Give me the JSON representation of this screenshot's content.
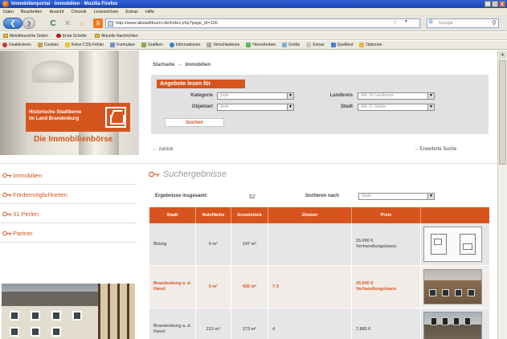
{
  "window": {
    "title": "Immobilienportal · Immobilien · Mozilla Firefox",
    "buttons": {
      "minimize": "_",
      "maximize": "□",
      "close": "X"
    }
  },
  "menu": [
    "Datei",
    "Bearbeiten",
    "Ansicht",
    "Chronik",
    "Lesezeichen",
    "Extras",
    "Hilfe"
  ],
  "nav": {
    "url": "http://www.altstadtbuero.de/index.php?page_id=156",
    "search_placeholder": "Google"
  },
  "bookmarks": [
    "Meistbesuchte Seiten",
    "Erste Schritte",
    "Aktuelle Nachrichten"
  ],
  "toolbar": [
    "Deaktivieren",
    "Cookies",
    "Keine CSS-Fehler",
    "Formulare",
    "Grafiken",
    "Informationen",
    "Verschiedenes",
    "Hervorheben",
    "Größe",
    "Extras",
    "Quelltext",
    "Optionen"
  ],
  "site": {
    "badge_line1": "Historische Stadtkerne",
    "badge_line2": "im Land Brandenburg",
    "title": "Die Immobilienbörse"
  },
  "breadcrumb": {
    "home": "Startseite",
    "sep": "→",
    "current": "Immobilien"
  },
  "search": {
    "heading": "Angebote lesen für",
    "kategorie_label": "Kategorie",
    "kategorie_value": "Jede",
    "objektart_label": "Objektart",
    "objektart_value": "Jede",
    "landkreis_label": "Landkreis",
    "landkreis_value": "Alle 14 Landkreise",
    "stadt_label": "Stadt",
    "stadt_value": "Alle 31 Städte",
    "submit": "Suchen"
  },
  "links": {
    "back": "zurück",
    "advanced": "Erweiterte Suche"
  },
  "sidebar": [
    {
      "label": "Immobilien"
    },
    {
      "label": "Fördermöglichkeiten"
    },
    {
      "label": "31 Perlen"
    },
    {
      "label": "Partner"
    }
  ],
  "results": {
    "title": "Suchergebnisse",
    "count_label": "Ergebnisse insgesamt:",
    "count": "52",
    "sort_label": "Sortieren nach",
    "sort_value": "Stadt",
    "columns": [
      "Stadt",
      "Nutzfläche",
      "Grundstück",
      "Zimmer",
      "Preis",
      ""
    ],
    "rows": [
      {
        "stadt": "Belzig",
        "nutzflaeche": "0 m²",
        "grundstueck": "147 m²",
        "zimmer": "",
        "preis": "15.000 €",
        "preis2": "Verhandlungsbasis",
        "image": "floor-plan",
        "highlight": false
      },
      {
        "stadt": "Brandenburg a. d. Havel",
        "nutzflaeche": "0 m²",
        "grundstueck": "426 m²",
        "zimmer": "7-3",
        "preis": "25.000 €",
        "preis2": "Verhandlungsbasis",
        "image": "house-photo",
        "highlight": true
      },
      {
        "stadt": "Brandenburg a. d. Havel",
        "nutzflaeche": "213 m²",
        "grundstueck": "173 m²",
        "zimmer": "4",
        "preis": "7.885 €",
        "preis2": "",
        "image": "building-photo",
        "highlight": false
      }
    ]
  },
  "colors": {
    "accent": "#d6551e",
    "panel": "#e1e1e3",
    "row_grey": "#e6e6e8",
    "row_highlight": "#f2ece8"
  }
}
